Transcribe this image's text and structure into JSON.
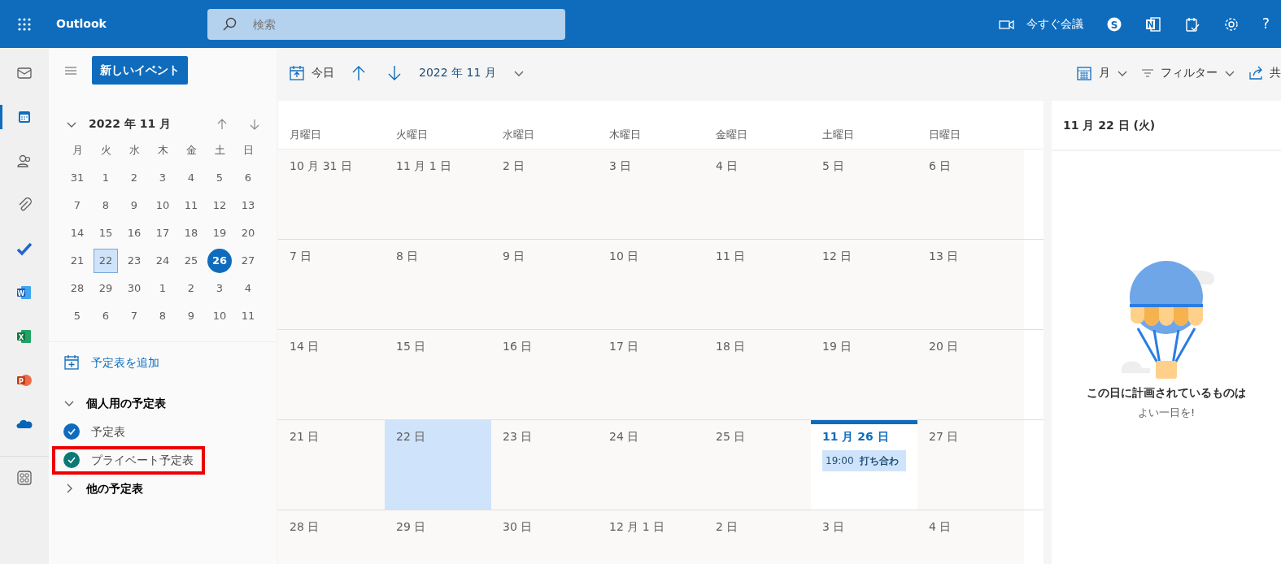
{
  "topbar": {
    "app_title": "Outlook",
    "search": {
      "placeholder": "検索"
    },
    "meet_now": "今すぐ会議",
    "actions": [
      {
        "kind": "skype",
        "glyph": "S"
      },
      {
        "kind": "onenote",
        "glyph": "N"
      },
      {
        "kind": "tasks"
      },
      {
        "kind": "settings"
      },
      {
        "kind": "help",
        "glyph": "?"
      }
    ]
  },
  "rail": [
    {
      "kind": "mail",
      "selected": false
    },
    {
      "kind": "calendar",
      "selected": true
    },
    {
      "kind": "people",
      "selected": false
    },
    {
      "kind": "attach",
      "selected": false
    },
    {
      "kind": "todo",
      "selected": false
    },
    {
      "kind": "word",
      "selected": false,
      "glyph": "W"
    },
    {
      "kind": "excel",
      "selected": false,
      "glyph": "X"
    },
    {
      "kind": "powerpoint",
      "selected": false,
      "glyph": "P"
    },
    {
      "kind": "onedrive",
      "selected": false
    },
    {
      "kind": "apps",
      "selected": false
    }
  ],
  "sidebar": {
    "new_event": "新しいイベント",
    "mini_calendar": {
      "title": "2022 年 11 月",
      "weekdays": [
        "月",
        "火",
        "水",
        "木",
        "金",
        "土",
        "日"
      ],
      "weeks": [
        [
          {
            "day": "31",
            "selected": false,
            "today": false
          },
          {
            "day": "1",
            "selected": false,
            "today": false
          },
          {
            "day": "2",
            "selected": false,
            "today": false
          },
          {
            "day": "3",
            "selected": false,
            "today": false
          },
          {
            "day": "4",
            "selected": false,
            "today": false
          },
          {
            "day": "5",
            "selected": false,
            "today": false
          },
          {
            "day": "6",
            "selected": false,
            "today": false
          }
        ],
        [
          {
            "day": "7",
            "selected": false,
            "today": false
          },
          {
            "day": "8",
            "selected": false,
            "today": false
          },
          {
            "day": "9",
            "selected": false,
            "today": false
          },
          {
            "day": "10",
            "selected": false,
            "today": false
          },
          {
            "day": "11",
            "selected": false,
            "today": false
          },
          {
            "day": "12",
            "selected": false,
            "today": false
          },
          {
            "day": "13",
            "selected": false,
            "today": false
          }
        ],
        [
          {
            "day": "14",
            "selected": false,
            "today": false
          },
          {
            "day": "15",
            "selected": false,
            "today": false
          },
          {
            "day": "16",
            "selected": false,
            "today": false
          },
          {
            "day": "17",
            "selected": false,
            "today": false
          },
          {
            "day": "18",
            "selected": false,
            "today": false
          },
          {
            "day": "19",
            "selected": false,
            "today": false
          },
          {
            "day": "20",
            "selected": false,
            "today": false
          }
        ],
        [
          {
            "day": "21",
            "selected": false,
            "today": false
          },
          {
            "day": "22",
            "selected": true,
            "today": false
          },
          {
            "day": "23",
            "selected": false,
            "today": false
          },
          {
            "day": "24",
            "selected": false,
            "today": false
          },
          {
            "day": "25",
            "selected": false,
            "today": false
          },
          {
            "day": "26",
            "selected": false,
            "today": true
          },
          {
            "day": "27",
            "selected": false,
            "today": false
          }
        ],
        [
          {
            "day": "28",
            "selected": false,
            "today": false
          },
          {
            "day": "29",
            "selected": false,
            "today": false
          },
          {
            "day": "30",
            "selected": false,
            "today": false
          },
          {
            "day": "1",
            "selected": false,
            "today": false
          },
          {
            "day": "2",
            "selected": false,
            "today": false
          },
          {
            "day": "3",
            "selected": false,
            "today": false
          },
          {
            "day": "4",
            "selected": false,
            "today": false
          }
        ],
        [
          {
            "day": "5",
            "selected": false,
            "today": false
          },
          {
            "day": "6",
            "selected": false,
            "today": false
          },
          {
            "day": "7",
            "selected": false,
            "today": false
          },
          {
            "day": "8",
            "selected": false,
            "today": false
          },
          {
            "day": "9",
            "selected": false,
            "today": false
          },
          {
            "day": "10",
            "selected": false,
            "today": false
          },
          {
            "day": "11",
            "selected": false,
            "today": false
          }
        ]
      ]
    },
    "add_calendar": "予定表を追加",
    "groups": [
      {
        "title": "個人用の予定表",
        "expanded": true,
        "items": [
          {
            "label": "予定表",
            "checked": true,
            "color": "#0f6cbd",
            "highlighted": false
          },
          {
            "label": "プライベート予定表",
            "checked": true,
            "color": "#0b7a75",
            "highlighted": true
          }
        ]
      },
      {
        "title": "他の予定表",
        "expanded": false
      }
    ]
  },
  "toolbar": {
    "today": "今日",
    "period": "2022 年 11 月",
    "view": "月",
    "filter": "フィルター",
    "share": "共"
  },
  "calendar": {
    "weekdays": [
      "月曜日",
      "火曜日",
      "水曜日",
      "木曜日",
      "金曜日",
      "土曜日",
      "日曜日"
    ],
    "weeks": [
      [
        {
          "label": "10 月 31 日",
          "selected": false,
          "today": false
        },
        {
          "label": "11 月 1 日",
          "selected": false,
          "today": false
        },
        {
          "label": "2 日",
          "selected": false,
          "today": false
        },
        {
          "label": "3 日",
          "selected": false,
          "today": false
        },
        {
          "label": "4 日",
          "selected": false,
          "today": false
        },
        {
          "label": "5 日",
          "selected": false,
          "today": false
        },
        {
          "label": "6 日",
          "selected": false,
          "today": false
        }
      ],
      [
        {
          "label": "7 日",
          "selected": false,
          "today": false
        },
        {
          "label": "8 日",
          "selected": false,
          "today": false
        },
        {
          "label": "9 日",
          "selected": false,
          "today": false
        },
        {
          "label": "10 日",
          "selected": false,
          "today": false
        },
        {
          "label": "11 日",
          "selected": false,
          "today": false
        },
        {
          "label": "12 日",
          "selected": false,
          "today": false
        },
        {
          "label": "13 日",
          "selected": false,
          "today": false
        }
      ],
      [
        {
          "label": "14 日",
          "selected": false,
          "today": false
        },
        {
          "label": "15 日",
          "selected": false,
          "today": false
        },
        {
          "label": "16 日",
          "selected": false,
          "today": false
        },
        {
          "label": "17 日",
          "selected": false,
          "today": false
        },
        {
          "label": "18 日",
          "selected": false,
          "today": false
        },
        {
          "label": "19 日",
          "selected": false,
          "today": false
        },
        {
          "label": "20 日",
          "selected": false,
          "today": false
        }
      ],
      [
        {
          "label": "21 日",
          "selected": false,
          "today": false
        },
        {
          "label": "22 日",
          "selected": true,
          "today": false
        },
        {
          "label": "23 日",
          "selected": false,
          "today": false
        },
        {
          "label": "24 日",
          "selected": false,
          "today": false
        },
        {
          "label": "25 日",
          "selected": false,
          "today": false
        },
        {
          "label": "11 月 26 日",
          "selected": false,
          "today": true,
          "events": [
            {
              "time": "19:00",
              "title": "打ち合わ"
            }
          ]
        },
        {
          "label": "27 日",
          "selected": false,
          "today": false
        }
      ],
      [
        {
          "label": "28 日",
          "selected": false,
          "today": false
        },
        {
          "label": "29 日",
          "selected": false,
          "today": false
        },
        {
          "label": "30 日",
          "selected": false,
          "today": false
        },
        {
          "label": "12 月 1 日",
          "selected": false,
          "today": false
        },
        {
          "label": "2 日",
          "selected": false,
          "today": false
        },
        {
          "label": "3 日",
          "selected": false,
          "today": false
        },
        {
          "label": "4 日",
          "selected": false,
          "today": false
        }
      ]
    ]
  },
  "day_panel": {
    "title": "11 月 22 日 (火)",
    "empty_title": "この日に計画されているものは",
    "empty_subtitle": "よい一日を!"
  }
}
